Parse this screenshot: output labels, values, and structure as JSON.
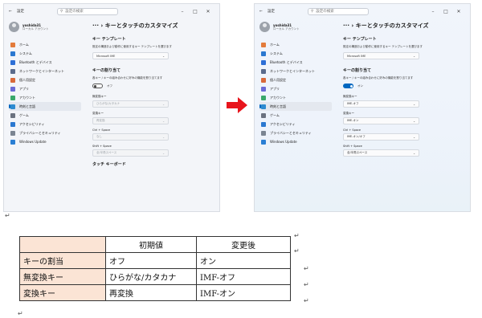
{
  "screens": {
    "before": {
      "back": "←",
      "app_name": "設定",
      "search_placeholder": "設定の検索",
      "window_controls": [
        "–",
        "□",
        "✕"
      ],
      "user": {
        "name": "yoshida31",
        "sub": "ローカル アカウント"
      },
      "nav": [
        "ホーム",
        "システム",
        "Bluetooth とデバイス",
        "ネットワークとインターネット",
        "個人用設定",
        "アプリ",
        "アカウント",
        "時刻と言語",
        "ゲーム",
        "アクセシビリティ",
        "プライバシーとセキュリティ",
        "Windows Update"
      ],
      "breadcrumb": "··· › キーとタッチのカスタマイズ",
      "template_heading": "キー テンプレート",
      "template_desc": "既定の構造および動作に使用するキー テンプレートを選びます",
      "template_value": "Microsoft IME",
      "assign_heading": "キーの割り当て",
      "assign_desc": "各キー / キーの組み合わせに好みの機能を割り当てます",
      "toggle_label": "オフ",
      "muhenkan_label": "無変換キー",
      "muhenkan_value": "ひらがな/カタカナ",
      "henkan_label": "変換キー",
      "henkan_value": "再変換",
      "ctrl_label": "Ctrl + Space",
      "ctrl_value": "なし",
      "shift_label": "Shift + Space",
      "shift_value": "全/半角スペース",
      "touch_heading": "タッチ キーボード"
    },
    "after": {
      "back": "←",
      "app_name": "設定",
      "search_placeholder": "設定の検索",
      "window_controls": [
        "–",
        "□",
        "✕"
      ],
      "user": {
        "name": "yoshida31",
        "sub": "ローカル アカウント"
      },
      "nav": [
        "ホーム",
        "システム",
        "Bluetooth とデバイス",
        "ネットワークとインターネット",
        "個人用設定",
        "アプリ",
        "アカウント",
        "時刻と言語",
        "ゲーム",
        "アクセシビリティ",
        "プライバシーとセキュリティ",
        "Windows Update"
      ],
      "breadcrumb": "··· › キーとタッチのカスタマイズ",
      "template_heading": "キー テンプレート",
      "template_desc": "既定の構造および動作に使用するキー テンプレートを選びます",
      "template_value": "Microsoft IME",
      "assign_heading": "キーの割り当て",
      "assign_desc": "各キー / キーの組み合わせに好みの機能を割り当てます",
      "toggle_label": "オン",
      "muhenkan_label": "無変換キー",
      "muhenkan_value": "IME-オフ",
      "henkan_label": "変換キー",
      "henkan_value": "IME-オン",
      "ctrl_label": "Ctrl + Space",
      "ctrl_value": "IME-オン/オフ",
      "shift_label": "Shift + Space",
      "shift_value": "全/半角スペース"
    }
  },
  "paragraph_mark": "↵",
  "table": {
    "headers": [
      "",
      "初期値",
      "変更後"
    ],
    "rows": [
      [
        "キーの割当",
        "オフ",
        "オン"
      ],
      [
        "無変換キー",
        "ひらがな/カタカナ",
        "IMF-オフ"
      ],
      [
        "変換キー",
        "再変換",
        "IMF-オン"
      ]
    ]
  },
  "colors": {
    "arrow": "#e8141c",
    "header_shade": "#fbe4d5",
    "accent": "#0067c0"
  },
  "nav_icon_colors": [
    "#e37b3b",
    "#2b78d0",
    "#2d6fd6",
    "#5a6b8c",
    "#d96a3a",
    "#6b6bd6",
    "#3aa86b",
    "#2e8bd0",
    "#6b7280",
    "#2b78d0",
    "#7b8592",
    "#2a7fd4"
  ]
}
